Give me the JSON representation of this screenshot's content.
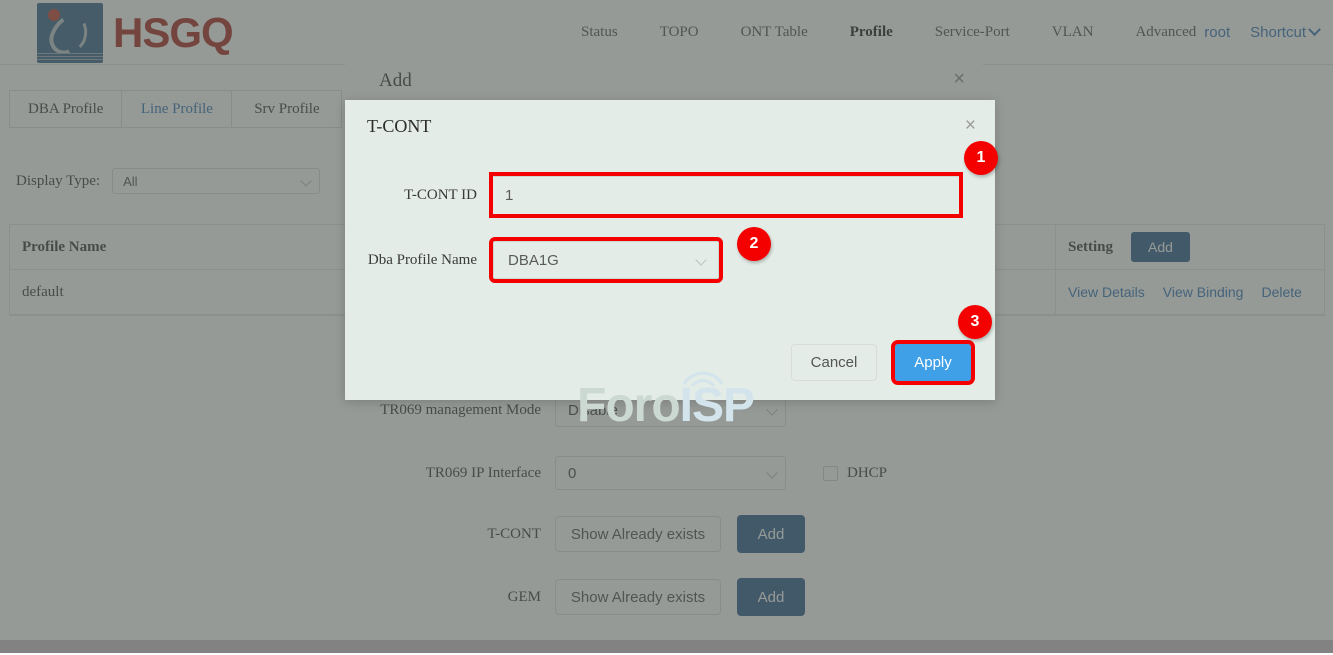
{
  "brand": {
    "name": "HSGQ"
  },
  "nav": {
    "items": [
      {
        "label": "Status",
        "active": false
      },
      {
        "label": "TOPO",
        "active": false
      },
      {
        "label": "ONT Table",
        "active": false
      },
      {
        "label": "Profile",
        "active": true
      },
      {
        "label": "Service-Port",
        "active": false
      },
      {
        "label": "VLAN",
        "active": false
      },
      {
        "label": "Advanced",
        "active": false
      }
    ],
    "user": "root",
    "shortcut": "Shortcut"
  },
  "tabs": [
    {
      "label": "DBA Profile",
      "active": false
    },
    {
      "label": "Line Profile",
      "active": true
    },
    {
      "label": "Srv Profile",
      "active": false
    }
  ],
  "filter": {
    "label": "Display Type:",
    "value": "All"
  },
  "table": {
    "columns": [
      "Profile Name",
      "Setting"
    ],
    "add_label": "Add",
    "rows": [
      {
        "profile_name": "default",
        "actions": [
          "View Details",
          "View Binding",
          "Delete"
        ]
      }
    ]
  },
  "add_panel": {
    "title": "Add",
    "close": "×",
    "fields": [
      {
        "label": "TR069 management Mode",
        "value": "Disable"
      },
      {
        "label": "TR069 IP Interface",
        "value": "0"
      }
    ],
    "dhcp_label": "DHCP",
    "tcont_label": "T-CONT",
    "gem_label": "GEM",
    "show_exists_label": "Show Already exists",
    "add_label": "Add"
  },
  "tcont_modal": {
    "title": "T-CONT",
    "close": "×",
    "tcont_id_label": "T-CONT ID",
    "tcont_id_value": "1",
    "dba_label": "Dba Profile Name",
    "dba_value": "DBA1G",
    "cancel_label": "Cancel",
    "apply_label": "Apply"
  },
  "watermark": {
    "part1": "Foro",
    "part2": "ISP"
  },
  "annotations": [
    {
      "number": "1"
    },
    {
      "number": "2"
    },
    {
      "number": "3"
    }
  ],
  "colors": {
    "brand_red": "#a52019",
    "link_blue": "#2a6fb5",
    "button_blue": "#23558c",
    "apply_blue": "#3fa0e8",
    "annotation_red": "#f40000",
    "modal_bg": "#e3ece7"
  }
}
